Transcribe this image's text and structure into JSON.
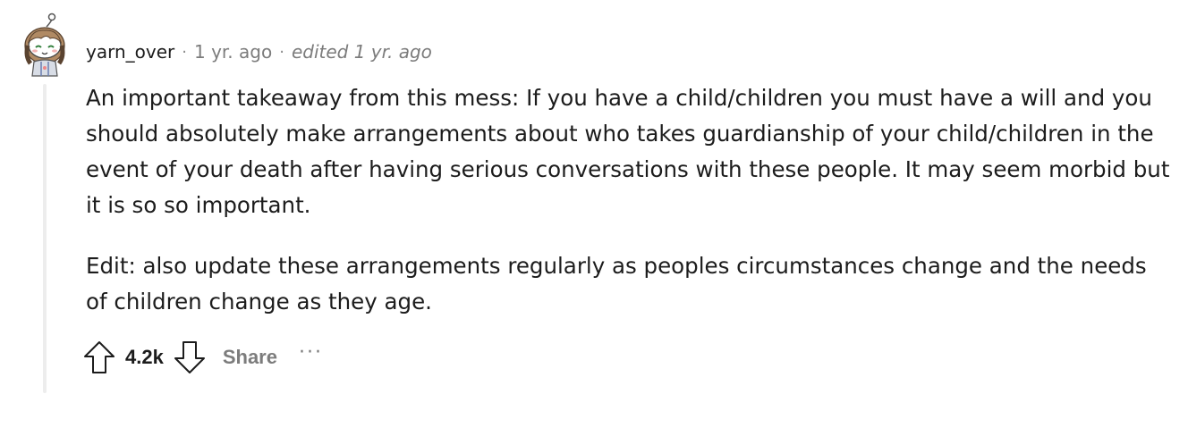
{
  "comment": {
    "username": "yarn_over",
    "separator": "·",
    "time": "1 yr. ago",
    "edited": "edited 1 yr. ago",
    "paragraphs": [
      "An important takeaway from this mess: If you have a child/children you must have a will and you should absolutely make arrangements about who takes guardianship of your child/children in the event of your death after having serious conversations with these people. It may seem morbid but it is so so important.",
      "Edit: also update these arrangements regularly as peoples circumstances change and the needs of children change as they age."
    ],
    "score": "4.2k",
    "share_label": "Share",
    "more_label": "···",
    "icons": {
      "upvote": "upvote-arrow-icon",
      "downvote": "downvote-arrow-icon",
      "avatar": "snoo-avatar"
    }
  }
}
